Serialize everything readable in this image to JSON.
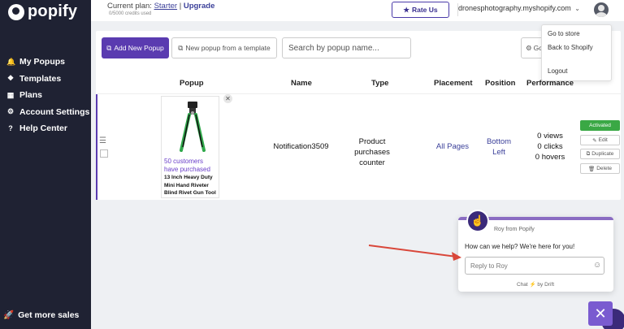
{
  "sidebar": {
    "logo_text": "popify",
    "items": [
      {
        "label": "My Popups",
        "icon": "bell-icon"
      },
      {
        "label": "Templates",
        "icon": "layers-icon"
      },
      {
        "label": "Plans",
        "icon": "grid-icon"
      },
      {
        "label": "Account Settings",
        "icon": "gear-icon"
      },
      {
        "label": "Help Center",
        "icon": "question-icon"
      }
    ],
    "bottom_label": "Get more sales"
  },
  "topbar": {
    "plan_prefix": "Current plan:",
    "plan_name": "Starter",
    "separator": "|",
    "upgrade": "Upgrade",
    "credits": "0/5000 credits used",
    "rate_label": "Rate Us",
    "shop": "dronesphotography.myshopify.com"
  },
  "dropdown": {
    "go_to_store": "Go to store",
    "back_to_shopify": "Back to Shopify",
    "logout": "Logout"
  },
  "toolbar": {
    "add_new": "Add New Popup",
    "from_template": "New popup from a template",
    "search_placeholder": "Search by popup name...",
    "settings_label": "Go"
  },
  "table": {
    "headers": [
      "Popup",
      "Name",
      "Type",
      "Placement",
      "Position",
      "Performance"
    ],
    "row": {
      "preview_count": "50 customers have purchased",
      "preview_product": "13 Inch Heavy Duty Mini Hand Riveter Blind Rivet Gun Tool",
      "name": "Notification3509",
      "type": "Product purchases counter",
      "placement": "All Pages",
      "position": "Bottom Left",
      "views": "0 views",
      "clicks": "0 clicks",
      "hovers": "0 hovers",
      "status": "Activated",
      "edit": "Edit",
      "duplicate": "Duplicate",
      "delete": "Delete"
    }
  },
  "chat": {
    "from": "Roy from Popify",
    "message": "How can we help? We're here for you!",
    "reply_placeholder": "Reply to Roy",
    "footer": "Chat ⚡ by Drift",
    "launcher": "✕"
  },
  "colors": {
    "sidebar_bg": "#1f2233",
    "primary": "#5a3bb0",
    "link": "#3a3f99",
    "activated": "#3aa845"
  }
}
